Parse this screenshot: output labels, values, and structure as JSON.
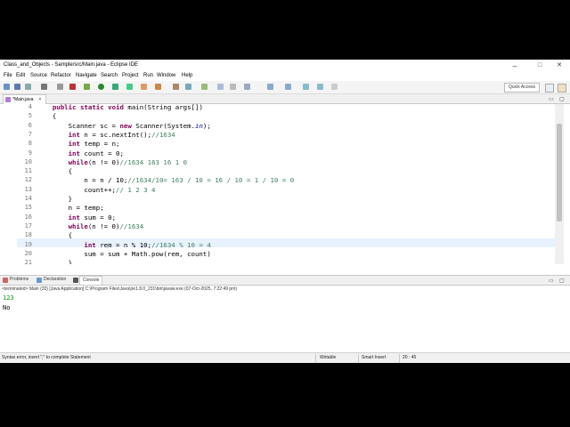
{
  "window": {
    "title": "Class_and_Objects - Sample/src/Main.java - Eclipse IDE",
    "controls": {
      "minimize": "–",
      "maximize": "□",
      "close": "✕"
    }
  },
  "menu": [
    "File",
    "Edit",
    "Source",
    "Refactor",
    "Navigate",
    "Search",
    "Project",
    "Run",
    "Window",
    "Help"
  ],
  "toolbar": {
    "quick_access": "Quick Access"
  },
  "editor": {
    "tab_label": "*Main.java",
    "lines": [
      {
        "num": "4",
        "text": "    public static void main(String args[])"
      },
      {
        "num": "5",
        "text": "    {"
      },
      {
        "num": "6",
        "text": "        Scanner sc = new Scanner(System.in);"
      },
      {
        "num": "7",
        "text": "        int n = sc.nextInt();//1634"
      },
      {
        "num": "8",
        "text": "        int temp = n;"
      },
      {
        "num": "9",
        "text": "        int count = 0;"
      },
      {
        "num": "10",
        "text": "        while(n != 0)//1634 163 16 1 0"
      },
      {
        "num": "11",
        "text": "        {"
      },
      {
        "num": "12",
        "text": "            n = n / 10;//1634/10= 163 / 10 = 16 / 10 = 1 / 10 = 0"
      },
      {
        "num": "13",
        "text": "            count++;// 1 2 3 4"
      },
      {
        "num": "14",
        "text": "        }"
      },
      {
        "num": "15",
        "text": "        n = temp;"
      },
      {
        "num": "16",
        "text": "        int sum = 0;"
      },
      {
        "num": "17",
        "text": "        while(n != 0)//1634"
      },
      {
        "num": "18",
        "text": "        {"
      },
      {
        "num": "19",
        "text": "            int rem = n % 10;//1634 % 10 = 4"
      },
      {
        "num": "20",
        "text": "            sum = sum + Math.pow(rem, count)"
      },
      {
        "num": "21",
        "text": "        }"
      }
    ]
  },
  "console": {
    "tabs": [
      "Problems",
      "Declaration",
      "Console"
    ],
    "terminated": "<terminated> Main (33) [Java Application] C:\\Program Files\\Java\\jre1.8.0_231\\bin\\javaw.exe (07-Oct-2025, 7:22:49 pm)",
    "output": [
      "123",
      "No"
    ]
  },
  "status": {
    "message": "Syntax error, insert \";\" to complete Statement",
    "writable": "Writable",
    "insert_mode": "Smart Insert",
    "position": "20 : 45"
  },
  "colors": {
    "keyword": "#7f0055",
    "comment": "#3f7f5f",
    "field": "#0000c0",
    "input": "#00a000"
  },
  "icons": [
    "eclipse-icon",
    "java-file-icon",
    "console-icon",
    "problems-icon",
    "declaration-icon",
    "perspective-icon"
  ]
}
